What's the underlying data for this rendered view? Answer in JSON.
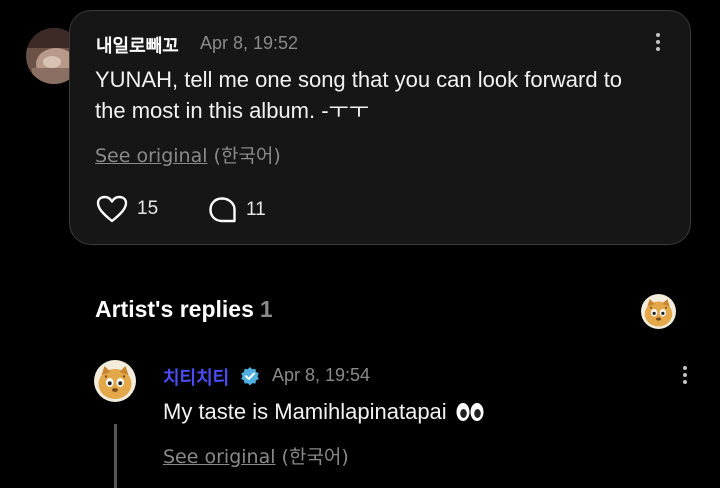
{
  "comment": {
    "username": "내일로빼꼬",
    "timestamp": "Apr 8, 19:52",
    "text_line1": "YUNAH, tell me one song that you can look forward to",
    "text_line2": "the most in this album. -ㅜㅜ",
    "see_original": "See original",
    "language": "(한국어)",
    "likes": "15",
    "replies": "11"
  },
  "artist_replies": {
    "title": "Artist's replies",
    "count": "1"
  },
  "reply": {
    "username": "치티치티",
    "timestamp": "Apr 8, 19:54",
    "text": "My taste is Mamihlapinatapai",
    "see_original": "See original",
    "language": "(한국어)"
  },
  "icons": {
    "like": "heart-icon",
    "comment": "comment-bubble-icon",
    "more": "more-vertical-icon",
    "verified": "verified-badge-icon",
    "eyes": "eyes-emoji-icon"
  },
  "colors": {
    "background": "#000000",
    "card": "#161616",
    "artist_name": "#4b4ef7",
    "verified": "#4fb0e0",
    "muted": "#8a8a8a"
  }
}
